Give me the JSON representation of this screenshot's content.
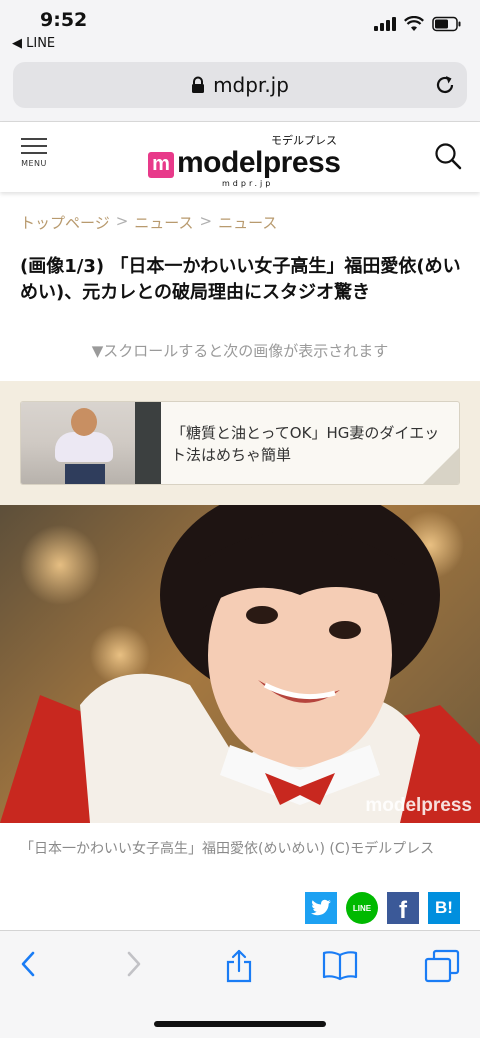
{
  "status_bar": {
    "time": "9:52",
    "back_app": "◀ LINE"
  },
  "browser": {
    "url": "mdpr.jp"
  },
  "site": {
    "menu_label": "MENU",
    "logo_text": "modelpress",
    "logo_kana": "モデルプレス",
    "logo_domain": "mdpr.jp"
  },
  "breadcrumb": [
    "トップページ",
    "ニュース",
    "ニュース"
  ],
  "article": {
    "title": "(画像1/3) 「日本一かわいい女子高生」福田愛依(めいめい)、元カレとの破局理由にスタジオ驚き",
    "scroll_hint": "▼スクロールすると次の画像が表示されます"
  },
  "related": {
    "text": "「糖質と油とってOK」HG妻のダイエット法はめちゃ簡単"
  },
  "photo": {
    "watermark": "modelpress",
    "caption": "「日本一かわいい女子高生」福田愛依(めいめい) (C)モデルプレス"
  },
  "share": {
    "line_label": "LINE",
    "hatena_label": "B!",
    "facebook_label": "f"
  },
  "colors": {
    "brand_pink": "#e83a8a",
    "breadcrumb": "#b89a6e",
    "safari_blue": "#1a7cf5",
    "twitter": "#1da1f2",
    "line": "#00b900",
    "facebook": "#3b5998",
    "hatena": "#008fde"
  }
}
